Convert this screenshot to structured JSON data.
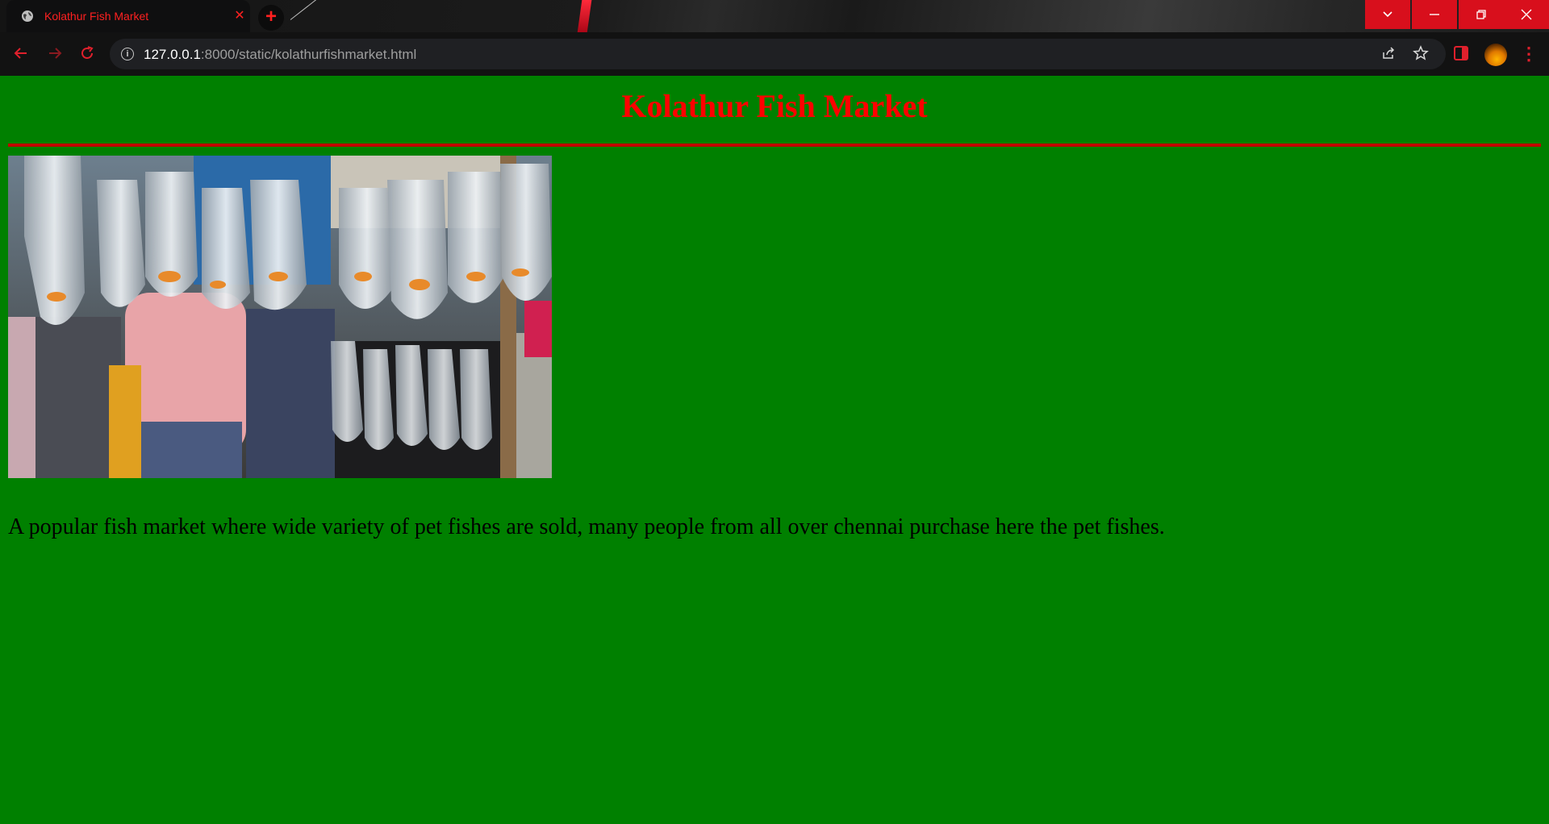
{
  "browser": {
    "tab_title": "Kolathur Fish Market",
    "url_host": "127.0.0.1",
    "url_path": ":8000/static/kolathurfishmarket.html"
  },
  "page": {
    "heading": "Kolathur Fish Market",
    "description": "A popular fish market where wide variety of pet fishes are sold, many people from all over chennai purchase here the pet fishes.",
    "background_color": "#008000",
    "heading_color": "#ff0000",
    "rule_color": "#c00000"
  },
  "icons": {
    "favicon": "globe-icon",
    "tab_close": "close-icon",
    "new_tab": "plus-icon",
    "tab_search": "chevron-down-icon",
    "minimize": "minimize-icon",
    "restore": "restore-icon",
    "close_window": "close-icon",
    "back": "back-arrow-icon",
    "forward": "forward-arrow-icon",
    "reload": "reload-icon",
    "site_info": "info-icon",
    "share": "share-icon",
    "bookmark": "star-icon",
    "side_panel": "side-panel-icon",
    "profile": "avatar",
    "menu": "more-vertical-icon"
  }
}
